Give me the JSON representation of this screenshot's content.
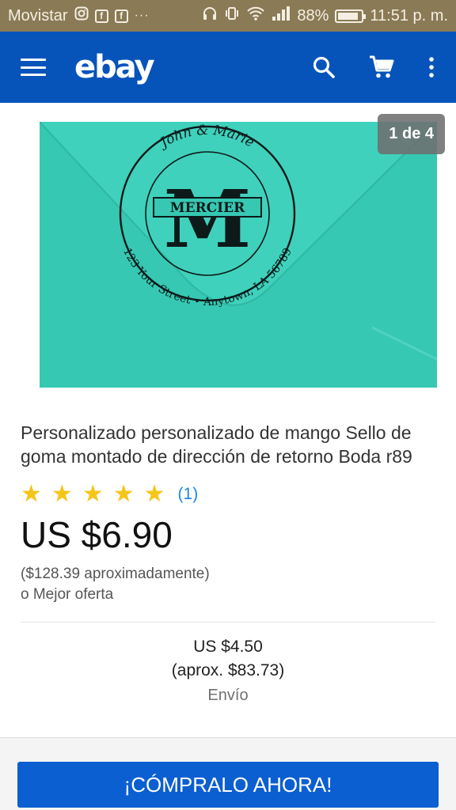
{
  "status_bar": {
    "carrier": "Movistar",
    "icons": [
      "instagram-icon",
      "facebook-icon",
      "facebook-icon",
      "more-dots-icon",
      "headset-icon",
      "vibrate-icon",
      "wifi-icon",
      "signal-icon"
    ],
    "battery_percent": "88%",
    "battery_level": 0.88,
    "time": "11:51 p. m."
  },
  "app_bar": {
    "logo": "ebay",
    "icons": [
      "menu-icon",
      "search-icon",
      "cart-icon",
      "overflow-menu-icon"
    ],
    "color": "#0654ba"
  },
  "gallery": {
    "counter": "1 de 4",
    "image": {
      "subject": "turquoise-envelope-with-stamp",
      "stamp_names": "John & Marie",
      "stamp_monogram": "M",
      "stamp_surname": "MERCIER",
      "stamp_address": "123 Your Street • Anytown, LA 56789",
      "envelope_color": "#36c8b2"
    }
  },
  "product": {
    "title": "Personalizado personalizado de mango Sello de goma montado de dirección de retorno Boda r89",
    "rating_stars": 5,
    "rating_count": "(1)",
    "price": "US $6.90",
    "price_approx": "($128.39 aproximadamente)",
    "best_offer": "o Mejor oferta"
  },
  "shipping": {
    "price": "US $4.50",
    "approx": "(aprox. $83.73)",
    "label": "Envío"
  },
  "actions": {
    "buy_now": "¡CÓMPRALO AHORA!",
    "accent_color": "#0b5fd1"
  },
  "colors": {
    "star": "#f5c518",
    "link": "#1e88e5"
  }
}
